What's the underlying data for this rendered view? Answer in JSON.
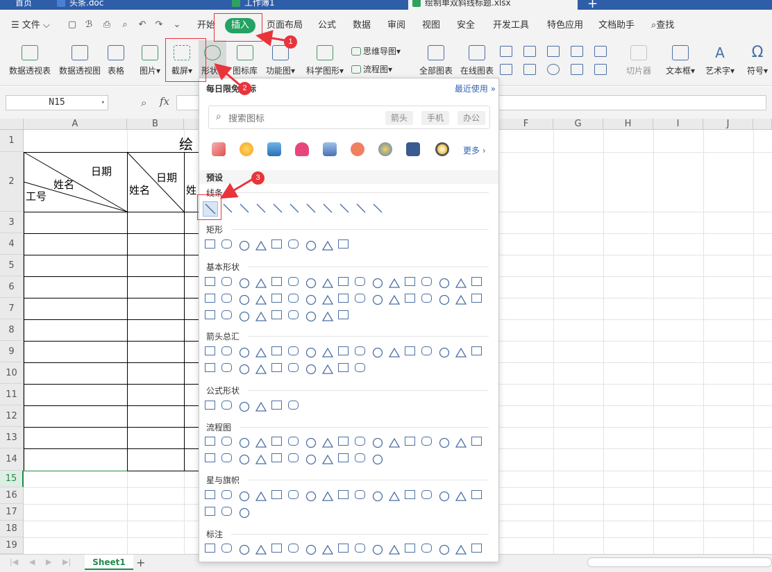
{
  "tabs": [
    {
      "label": "首页"
    },
    {
      "label": "头条.doc"
    },
    {
      "label": "工作簿1"
    },
    {
      "label": "绘制单双斜线标题.xlsx"
    }
  ],
  "menu": {
    "file": "文件",
    "items": [
      "开始",
      "插入",
      "页面布局",
      "公式",
      "数据",
      "审阅",
      "视图",
      "安全",
      "开发工具",
      "特色应用",
      "文档助手"
    ],
    "search": "查找"
  },
  "ribbon": {
    "pivot_table": "数据透视表",
    "pivot_chart": "数据透视图",
    "table": "表格",
    "picture": "图片",
    "screenshot": "截屏",
    "shapes": "形状",
    "icon_lib": "图标库",
    "func_chart": "功能图",
    "sci_shape": "科学图形",
    "mind_map": "思维导图",
    "flowchart": "流程图",
    "all_charts": "全部图表",
    "online_chart": "在线图表",
    "slicer": "切片器",
    "textbox": "文本框",
    "wordart": "艺术字",
    "symbol": "符号",
    "omega": "Ω"
  },
  "formula": {
    "namebox": "N15",
    "fx": "fx"
  },
  "sheet": {
    "columns": [
      "A",
      "B",
      "C",
      "D",
      "E",
      "F",
      "G",
      "H",
      "I",
      "J"
    ],
    "rows": [
      "1",
      "2",
      "3",
      "4",
      "5",
      "6",
      "7",
      "8",
      "9",
      "10",
      "11",
      "12",
      "13",
      "14",
      "15",
      "16",
      "17",
      "18",
      "19"
    ],
    "title_partial": "绘",
    "a2_date": "日期",
    "a2_name": "姓名",
    "a2_id": "工号",
    "b2_date": "日期",
    "b2_name": "姓名",
    "c2_partial": "姓"
  },
  "bottom": {
    "sheet_tab": "Sheet1",
    "add": "+"
  },
  "panel": {
    "title": "每日限免图标",
    "recent": "最近使用 »",
    "search_placeholder": "搜索图标",
    "tags": [
      "箭头",
      "手机",
      "办公"
    ],
    "more": "更多 ›",
    "preset": "预设",
    "sections": [
      "线条",
      "矩形",
      "基本形状",
      "箭头总汇",
      "公式形状",
      "流程图",
      "星与旗帜",
      "标注"
    ]
  },
  "annotations": [
    "1",
    "2",
    "3"
  ],
  "colors": {
    "accent_green": "#24a262",
    "annot_red": "#e8343a",
    "link_blue": "#3465b0"
  }
}
